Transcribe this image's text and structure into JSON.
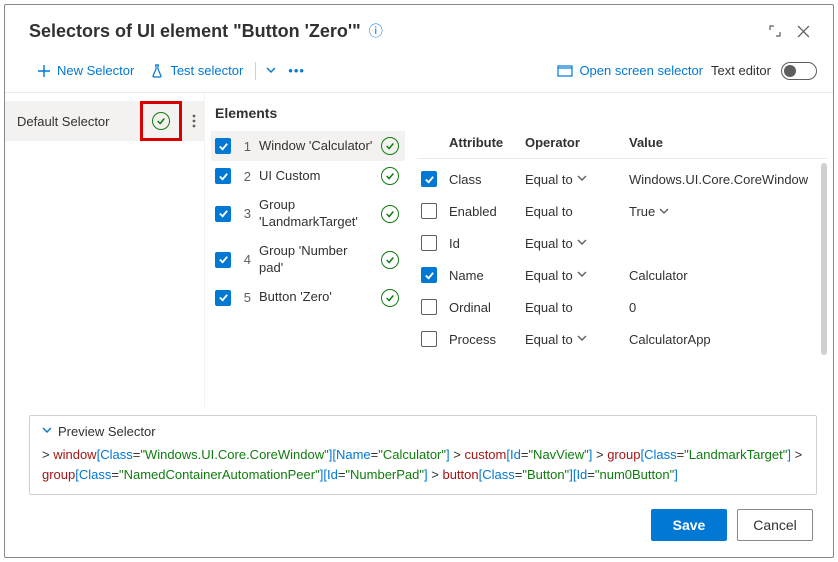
{
  "title": "Selectors of UI element \"Button 'Zero'\"",
  "toolbar": {
    "new_selector": "New Selector",
    "test_selector": "Test selector",
    "open_screen_selector": "Open screen selector",
    "text_editor": "Text editor"
  },
  "left": {
    "default_selector": "Default Selector"
  },
  "mid": {
    "title": "Elements",
    "items": [
      {
        "idx": "1",
        "label": "Window 'Calculator'",
        "checked": true,
        "selected": true
      },
      {
        "idx": "2",
        "label": "UI Custom",
        "checked": true,
        "selected": false
      },
      {
        "idx": "3",
        "label": "Group 'LandmarkTarget'",
        "checked": true,
        "selected": false
      },
      {
        "idx": "4",
        "label": "Group 'Number pad'",
        "checked": true,
        "selected": false
      },
      {
        "idx": "5",
        "label": "Button 'Zero'",
        "checked": true,
        "selected": false
      }
    ]
  },
  "attrs": {
    "head_attr": "Attribute",
    "head_op": "Operator",
    "head_val": "Value",
    "rows": [
      {
        "checked": true,
        "attr": "Class",
        "op": "Equal to",
        "chev": true,
        "val": "Windows.UI.Core.CoreWindow"
      },
      {
        "checked": false,
        "attr": "Enabled",
        "op": "Equal to",
        "chev": false,
        "val": "True",
        "val_chev": true
      },
      {
        "checked": false,
        "attr": "Id",
        "op": "Equal to",
        "chev": true,
        "val": ""
      },
      {
        "checked": true,
        "attr": "Name",
        "op": "Equal to",
        "chev": true,
        "val": "Calculator"
      },
      {
        "checked": false,
        "attr": "Ordinal",
        "op": "Equal to",
        "chev": false,
        "val": "0"
      },
      {
        "checked": false,
        "attr": "Process",
        "op": "Equal to",
        "chev": true,
        "val": "CalculatorApp"
      }
    ]
  },
  "preview": {
    "label": "Preview Selector",
    "tokens": [
      {
        "t": "gt",
        "v": "> "
      },
      {
        "t": "tag",
        "v": "window"
      },
      {
        "t": "brk",
        "v": "["
      },
      {
        "t": "key",
        "v": "Class"
      },
      {
        "t": "eq",
        "v": "="
      },
      {
        "t": "str",
        "v": "\"Windows.UI.Core.CoreWindow\""
      },
      {
        "t": "brk",
        "v": "]"
      },
      {
        "t": "brk",
        "v": "["
      },
      {
        "t": "key",
        "v": "Name"
      },
      {
        "t": "eq",
        "v": "="
      },
      {
        "t": "str",
        "v": "\"Calculator\""
      },
      {
        "t": "brk",
        "v": "]"
      },
      {
        "t": "gt",
        "v": " > "
      },
      {
        "t": "tag",
        "v": "custom"
      },
      {
        "t": "brk",
        "v": "["
      },
      {
        "t": "key",
        "v": "Id"
      },
      {
        "t": "eq",
        "v": "="
      },
      {
        "t": "str",
        "v": "\"NavView\""
      },
      {
        "t": "brk",
        "v": "]"
      },
      {
        "t": "gt",
        "v": " > "
      },
      {
        "t": "tag",
        "v": "group"
      },
      {
        "t": "brk",
        "v": "["
      },
      {
        "t": "key",
        "v": "Class"
      },
      {
        "t": "eq",
        "v": "="
      },
      {
        "t": "str",
        "v": "\"LandmarkTarget\""
      },
      {
        "t": "brk",
        "v": "]"
      },
      {
        "t": "gt",
        "v": " > "
      },
      {
        "t": "tag",
        "v": "group"
      },
      {
        "t": "brk",
        "v": "["
      },
      {
        "t": "key",
        "v": "Class"
      },
      {
        "t": "eq",
        "v": "="
      },
      {
        "t": "str",
        "v": "\"NamedContainerAutomationPeer\""
      },
      {
        "t": "brk",
        "v": "]"
      },
      {
        "t": "brk",
        "v": "["
      },
      {
        "t": "key",
        "v": "Id"
      },
      {
        "t": "eq",
        "v": "="
      },
      {
        "t": "str",
        "v": "\"NumberPad\""
      },
      {
        "t": "brk",
        "v": "]"
      },
      {
        "t": "gt",
        "v": " > "
      },
      {
        "t": "tag",
        "v": "button"
      },
      {
        "t": "brk",
        "v": "["
      },
      {
        "t": "key",
        "v": "Class"
      },
      {
        "t": "eq",
        "v": "="
      },
      {
        "t": "str",
        "v": "\"Button\""
      },
      {
        "t": "brk",
        "v": "]"
      },
      {
        "t": "brk",
        "v": "["
      },
      {
        "t": "key",
        "v": "Id"
      },
      {
        "t": "eq",
        "v": "="
      },
      {
        "t": "str",
        "v": "\"num0Button\""
      },
      {
        "t": "brk",
        "v": "]"
      }
    ]
  },
  "footer": {
    "save": "Save",
    "cancel": "Cancel"
  }
}
